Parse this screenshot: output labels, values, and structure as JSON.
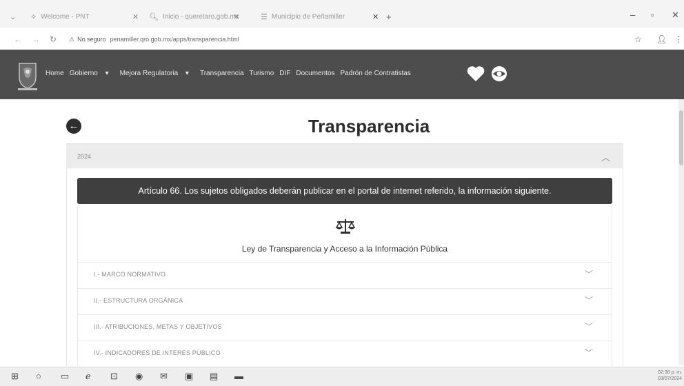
{
  "browser": {
    "tabs": [
      {
        "title": "Welcome - PNT",
        "icon": "globe-icon"
      },
      {
        "title": "Inicio - queretaro.gob.mx",
        "icon": "search-icon"
      },
      {
        "title": "Municipio de Peñamiller",
        "icon": "page-icon",
        "active": true
      }
    ],
    "new_tab": "+",
    "window_controls": [
      "–",
      "▫",
      "✕"
    ],
    "address": {
      "security_text": "No seguro",
      "url": "penamiller.qro.gob.mx/apps/transparencia.html"
    }
  },
  "site": {
    "logo": "municipio-logo",
    "menu": [
      {
        "label": "Home"
      },
      {
        "label": "Gobierno",
        "caret": "▾"
      },
      {
        "label": "Mejora Regulatoria",
        "caret": "▾"
      },
      {
        "label": "Transparencia"
      },
      {
        "label": "Turismo"
      },
      {
        "label": "DIF"
      },
      {
        "label": "Documentos"
      },
      {
        "label": "Padrón de Contratistas"
      }
    ],
    "icons": [
      "heart-icon",
      "eye-icon"
    ]
  },
  "content": {
    "back_icon": "arrow-left-icon",
    "title": "Transparencia",
    "year": "2024",
    "article": "Artículo 66. Los sujetos obligados deberán publicar en el portal de internet referido, la información siguiente.",
    "law_icon": "scale-icon",
    "law_title": "Ley de Transparencia y Acceso a la Información Pública",
    "items": [
      {
        "label": "I.- MARCO NORMATIVO"
      },
      {
        "label": "II.- ESTRUCTURA ORGÁNICA"
      },
      {
        "label": "III.- ATRIBUCIONES, METAS Y OBJETIVOS"
      },
      {
        "label": "IV.- INDICADORES DE INTERES PÚBLICO"
      }
    ]
  },
  "taskbar": {
    "icons": [
      "windows-icon",
      "search-icon",
      "task-view-icon",
      "edge-icon",
      "store-icon",
      "chrome-icon",
      "mail-icon",
      "photos-icon",
      "files-icon",
      "app-icon"
    ],
    "time": "02:38 p. m.",
    "date": "03/07/2024"
  },
  "colors": {
    "navbar": "#4d4d4d",
    "article_bg": "#3f3f3f",
    "accordion_header": "#ececec"
  }
}
